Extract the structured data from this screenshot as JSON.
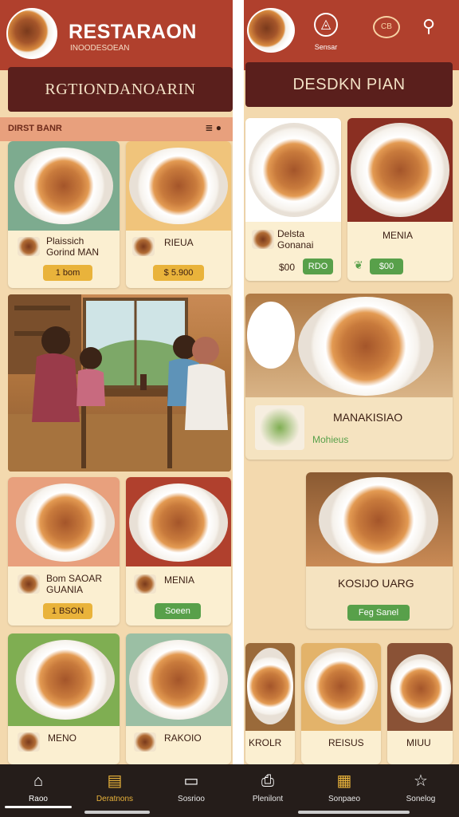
{
  "left": {
    "header": {
      "title": "RESTARAON",
      "subtitle": "INOODESOEAN"
    },
    "banner": "RGTIONDANOARIN",
    "section": {
      "label": "DIRST BANR",
      "icons": "≣ ●"
    },
    "cards": [
      {
        "title": "Plaissich\nGorind MAN",
        "price": "1 bom",
        "price_color": "#e9b33b",
        "bg": "#7dab8f"
      },
      {
        "title": "RIEUA",
        "price": "$ 5.900",
        "price_color": "#e9b33b",
        "bg": "#f0c47b"
      },
      {
        "title": "Bom SAOAR\nGUANIA",
        "price": "1 BSON",
        "price_color": "#e9b33b",
        "bg": "#e8a07d"
      },
      {
        "title": "MENIA",
        "price": "Soeen",
        "price_color": "#58a04a",
        "bg": "#b0402d"
      },
      {
        "title": "MENO",
        "price": "",
        "price_color": "",
        "bg": "#7fae52"
      },
      {
        "title": "RAKOIO",
        "price": "",
        "price_color": "",
        "bg": "#9bbfa4"
      }
    ]
  },
  "right": {
    "header_icons": [
      "home-diamond-icon",
      "chat-bubble-icon",
      "search-icon"
    ],
    "header_icon_label": "Sensar",
    "banner": "DESDKN PIAN",
    "cards": [
      {
        "title": "Delsta\nGonanai",
        "price_prefix": "$00",
        "price": "RDO",
        "price_color": "#58a04a",
        "bg": "#ffffff"
      },
      {
        "title": "MENIA",
        "price": "$00",
        "price_color": "#58a04a",
        "bg": "#8a2f22"
      }
    ],
    "feature": {
      "title": "MANAKISIAO",
      "sub": "Mohieus"
    },
    "feature2": {
      "title": "KOSIJO UARG",
      "price": "Feg Sanel"
    },
    "bottom_cards": [
      {
        "title": "KROLR"
      },
      {
        "title": "REISUS"
      },
      {
        "title": "MIUU"
      }
    ]
  },
  "tabs": [
    {
      "label": "Raoo",
      "icon": "home-icon",
      "active": true,
      "accent": "#ffffff"
    },
    {
      "label": "Deratnons",
      "icon": "book-icon",
      "active": false,
      "accent": "#e9b33b"
    },
    {
      "label": "Sosrioo",
      "icon": "inbox-icon",
      "active": false,
      "accent": ""
    },
    {
      "label": "Plenilont",
      "icon": "clipboard-icon",
      "active": false,
      "accent": ""
    },
    {
      "label": "Sonpaeo",
      "icon": "calendar-icon",
      "active": false,
      "accent": "#e9b33b"
    },
    {
      "label": "Sonelog",
      "icon": "star-icon",
      "active": false,
      "accent": ""
    }
  ]
}
